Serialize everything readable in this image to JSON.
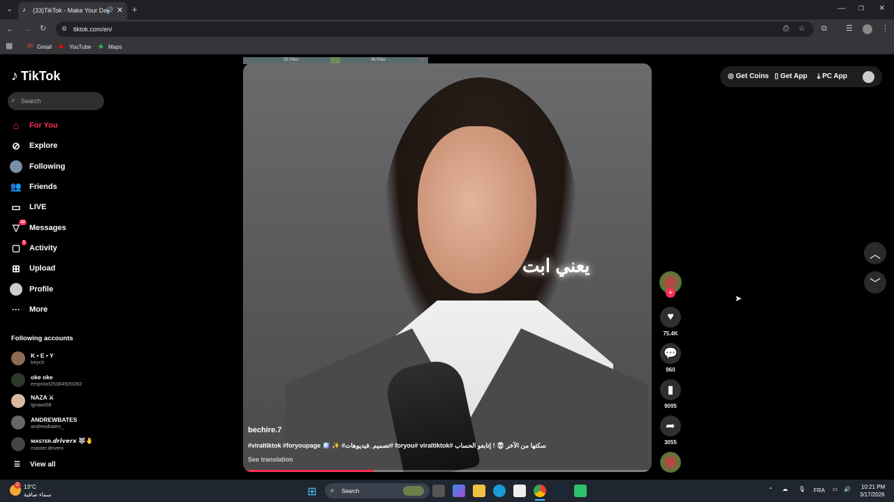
{
  "browser": {
    "tab_title": "(33)TikTok - Make Your Day",
    "url": "tiktok.com/en/",
    "bookmarks": [
      "Gmail",
      "YouTube",
      "Maps"
    ]
  },
  "tiktok": {
    "logo_text": "TikTok",
    "search_placeholder": "Search",
    "nav": [
      {
        "label": "For You",
        "badge": ""
      },
      {
        "label": "Explore",
        "badge": ""
      },
      {
        "label": "Following",
        "badge": ""
      },
      {
        "label": "Friends",
        "badge": ""
      },
      {
        "label": "LIVE",
        "badge": ""
      },
      {
        "label": "Messages",
        "badge": "32"
      },
      {
        "label": "Activity",
        "badge": "1"
      },
      {
        "label": "Upload",
        "badge": ""
      },
      {
        "label": "Profile",
        "badge": ""
      },
      {
        "label": "More",
        "badge": ""
      }
    ],
    "following_title": "Following accounts",
    "accounts": [
      {
        "name": "K • E • Y",
        "handle": "keych"
      },
      {
        "name": "oke oke",
        "handle": "emproot25384920282"
      },
      {
        "name": "NAZA ⚔",
        "handle": "lgnawi08"
      },
      {
        "name": "ANDREWBATES",
        "handle": "andrewbates_"
      },
      {
        "name": "ᴍᴀꜱᴛᴇʀ.𝙙𝙧𝙞𝙫𝙚𝙧𝙭 🐺🤚",
        "handle": "master.driverx"
      }
    ],
    "view_all": "View all",
    "top_right": {
      "coins": "Get Coins",
      "app": "Get App",
      "pc": "PC App"
    },
    "video": {
      "files_left": "55 Files",
      "files_right": "36 Files",
      "overlay_text": "يعني ابت",
      "author": "bechire.7",
      "description": "#viraltiktok #foryoupage 🪩 ✨ #تصميم_فيديوهات# foryou# viraltiktok# سكتها من الآخر 💀 ! إتابعو الحساب",
      "see_translation": "See translation",
      "progress": 0.32
    },
    "actions": {
      "likes": "75.4K",
      "comments": "960",
      "saves": "9095",
      "shares": "3055"
    }
  },
  "taskbar": {
    "weather_temp": "13°C",
    "weather_desc": "سماء صافية",
    "weather_badge": "2",
    "search_label": "Search",
    "lang": "FRA",
    "time": "10:21 PM",
    "date": "3/17/2026"
  }
}
